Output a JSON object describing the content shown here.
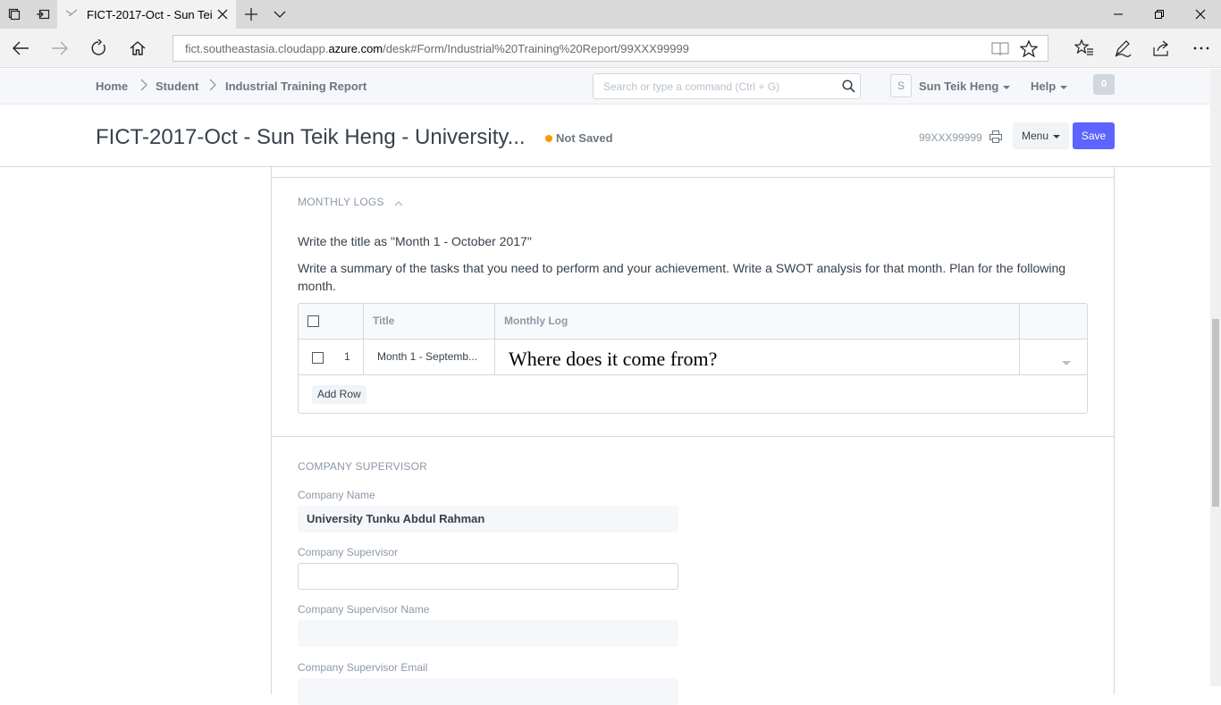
{
  "browser": {
    "tab_title": "FICT-2017-Oct - Sun Tei",
    "url_pre": "fict.southeastasia.cloudapp.",
    "url_host": "azure.com",
    "url_post": "/desk#Form/Industrial%20Training%20Report/99XXX99999"
  },
  "header": {
    "breadcrumbs": [
      "Home",
      "Student",
      "Industrial Training Report"
    ],
    "search_placeholder": "Search or type a command (Ctrl + G)",
    "avatar_letter": "S",
    "user_name": "Sun Teik Heng",
    "help_label": "Help",
    "notification_count": "0"
  },
  "titlebar": {
    "title": "FICT-2017-Oct - Sun Teik Heng - University...",
    "status": "Not Saved",
    "doc_name": "99XXX99999",
    "menu_label": "Menu",
    "save_label": "Save"
  },
  "monthly_logs": {
    "section_title": "MONTHLY LOGS",
    "help_1": "Write the title as \"Month 1 - October 2017\"",
    "help_2": "Write a summary of the tasks that you need to perform and your achievement. Write a SWOT analysis for that month. Plan for the following month.",
    "columns": [
      "Title",
      "Monthly Log"
    ],
    "rows": [
      {
        "idx": "1",
        "title": "Month 1 - Septemb...",
        "log": "Where does it come from?"
      }
    ],
    "add_row_label": "Add Row"
  },
  "company_supervisor": {
    "section_title": "COMPANY SUPERVISOR",
    "company_name_label": "Company Name",
    "company_name_value": "University Tunku Abdul Rahman",
    "supervisor_label": "Company Supervisor",
    "supervisor_name_label": "Company Supervisor Name",
    "supervisor_email_label": "Company Supervisor Email"
  }
}
